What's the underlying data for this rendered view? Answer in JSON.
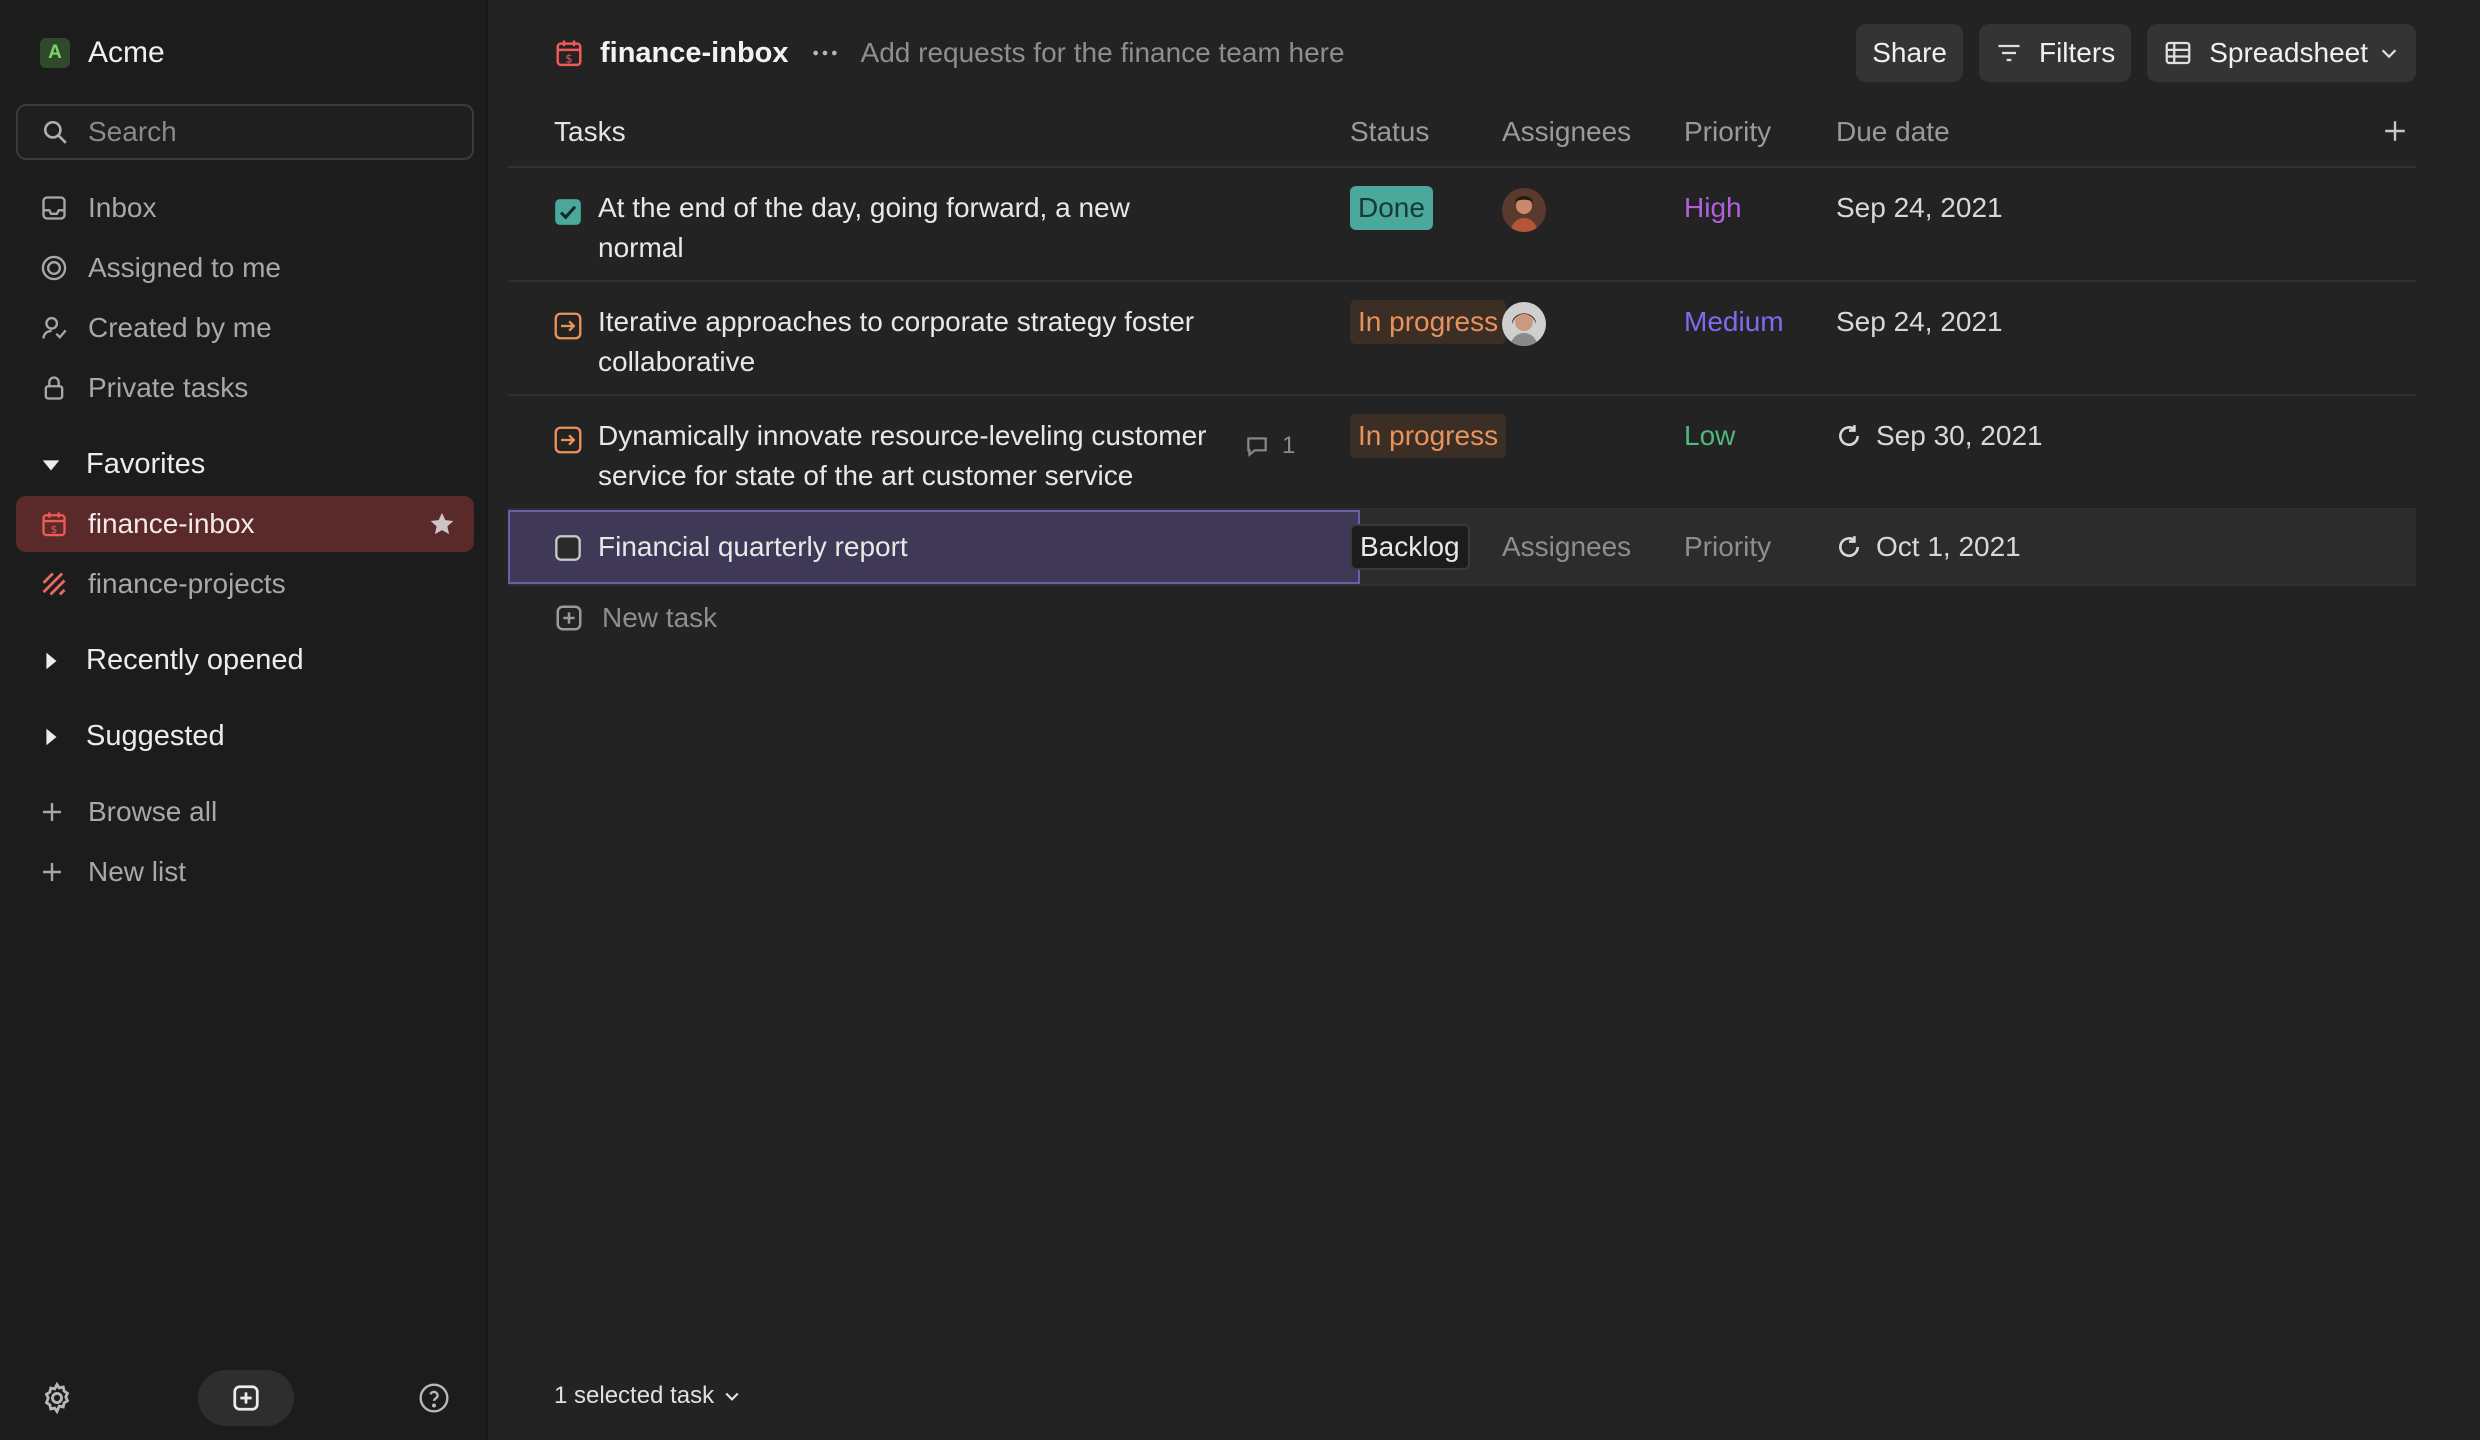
{
  "sidebar": {
    "workspace_initial": "A",
    "workspace_name": "Acme",
    "search_placeholder": "Search",
    "nav": [
      {
        "label": "Inbox",
        "icon": "inbox-icon"
      },
      {
        "label": "Assigned to me",
        "icon": "target-icon"
      },
      {
        "label": "Created by me",
        "icon": "user-icon"
      },
      {
        "label": "Private tasks",
        "icon": "lock-icon"
      }
    ],
    "favorites_label": "Favorites",
    "favorites": [
      {
        "label": "finance-inbox",
        "icon": "calendar-dollar-icon",
        "active": true,
        "starred": true
      },
      {
        "label": "finance-projects",
        "icon": "stripes-icon",
        "active": false
      }
    ],
    "recently_opened_label": "Recently opened",
    "suggested_label": "Suggested",
    "browse_all_label": "Browse all",
    "new_list_label": "New list"
  },
  "header": {
    "list_name": "finance-inbox",
    "description": "Add requests for the finance team here",
    "share_label": "Share",
    "filters_label": "Filters",
    "view_label": "Spreadsheet"
  },
  "table": {
    "columns": {
      "tasks": "Tasks",
      "status": "Status",
      "assignees": "Assignees",
      "priority": "Priority",
      "due": "Due date"
    },
    "rows": [
      {
        "title": "At the end of the day, going forward, a new normal",
        "status": "Done",
        "priority": "High",
        "due": "Sep 24, 2021",
        "comments": null
      },
      {
        "title": "Iterative approaches to corporate strategy foster collaborative",
        "status": "In progress",
        "priority": "Medium",
        "due": "Sep 24, 2021",
        "comments": null
      },
      {
        "title": "Dynamically innovate resource-leveling customer service for state of the art customer service",
        "status": "In progress",
        "priority": "Low",
        "due": "Sep 30, 2021",
        "comments": "1"
      },
      {
        "title": "Financial quarterly report",
        "status": "Backlog",
        "assignees_placeholder": "Assignees",
        "priority_placeholder": "Priority",
        "due": "Oct 1, 2021"
      }
    ],
    "new_task_label": "New task"
  },
  "footer": {
    "selection_label": "1 selected task"
  },
  "colors": {
    "accent_selected": "#3f3857",
    "done": "#4aa99a",
    "in_progress": "#e9925a",
    "priority_high": "#b45fe0",
    "priority_medium": "#7d6cf0",
    "priority_low": "#4fb87a"
  }
}
